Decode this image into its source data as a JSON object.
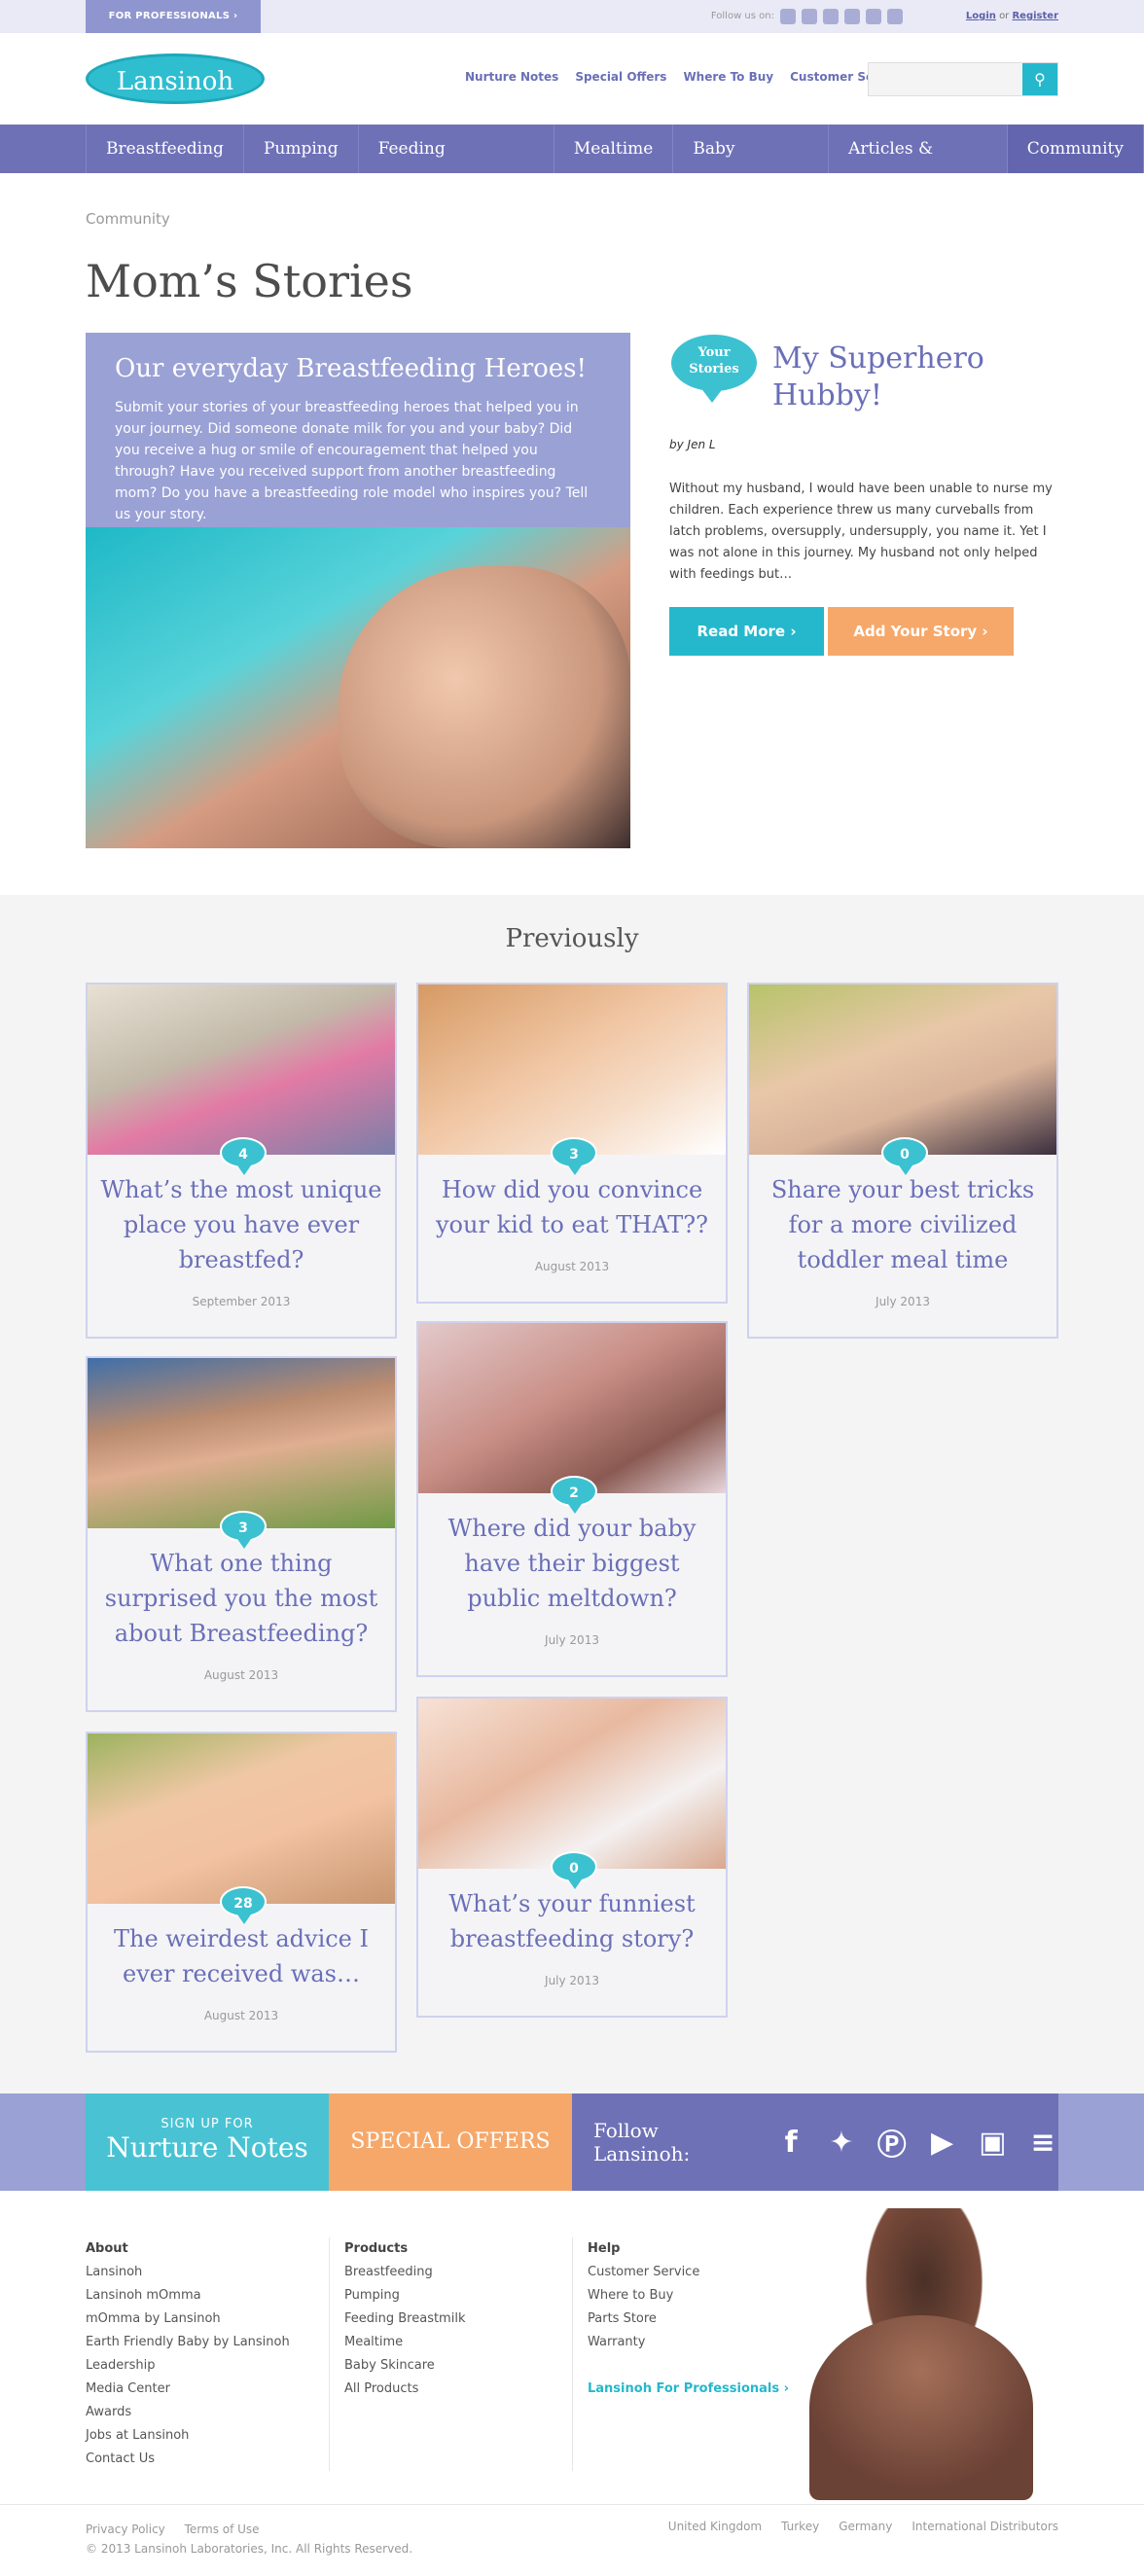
{
  "topbar": {
    "pro_label": "FOR PROFESSIONALS ›",
    "follow_label": "Follow us on:",
    "login": "Login",
    "or": "or",
    "register": "Register"
  },
  "header": {
    "logo": "Lansinoh",
    "util_nav": [
      "Nurture Notes",
      "Special Offers",
      "Where To Buy",
      "Customer Service"
    ],
    "search_placeholder": ""
  },
  "main_nav": [
    "Breastfeeding",
    "Pumping",
    "Feeding Breastmilk",
    "Mealtime",
    "Baby Skincare",
    "Articles & Videos",
    "Community"
  ],
  "breadcrumb": "Community",
  "page_title": "Mom’s Stories",
  "hero": {
    "heading": "Our everyday Breastfeeding Heroes!",
    "body": "Submit your stories of your breastfeeding heroes that helped you in your journey. Did someone donate milk for you and your baby? Did you receive a hug or smile of encouragement that helped you through? Have you received support from another breastfeeding mom? Do you have a breastfeeding role model who inspires you? Tell us your story."
  },
  "featured": {
    "bubble_line1": "Your",
    "bubble_line2": "Stories",
    "title": "My Superhero Hubby!",
    "byline": "by Jen L",
    "text": "Without my husband, I would have been unable to nurse my children. Each experience threw us many curveballs from latch problems, oversupply, undersupply, you name it. Yet I was not alone in this journey. My husband not only helped with feedings but…",
    "read_more": "Read More ›",
    "add_story": "Add Your Story ›"
  },
  "previously": {
    "title": "Previously",
    "cards": [
      {
        "count": "4",
        "question": "What’s the most unique place you have ever breastfed?",
        "date": "September 2013"
      },
      {
        "count": "3",
        "question": "How did you convince your kid to eat THAT??",
        "date": "August 2013"
      },
      {
        "count": "0",
        "question": "Share your best tricks for a more civilized toddler meal time",
        "date": "July 2013"
      },
      {
        "count": "3",
        "question": "What one thing surprised you the most about Breastfeeding?",
        "date": "August 2013"
      },
      {
        "count": "2",
        "question": "Where did your baby have their biggest public meltdown?",
        "date": "July 2013"
      },
      {
        "count": "28",
        "question": "The weirdest advice I ever received was…",
        "date": "August 2013"
      },
      {
        "count": "0",
        "question": "What’s your funniest breastfeeding story?",
        "date": "July 2013"
      }
    ]
  },
  "promo": {
    "signup_small": "SIGN UP FOR",
    "signup_big": "Nurture Notes",
    "special_offers": "SPECIAL OFFERS",
    "follow_label": "Follow Lansinoh:"
  },
  "footer": {
    "about_head": "About",
    "about": [
      "Lansinoh",
      "Lansinoh mOmma",
      "mOmma by Lansinoh",
      "Earth Friendly Baby by Lansinoh",
      "Leadership",
      "Media Center",
      "Awards",
      "Jobs at Lansinoh",
      "Contact Us"
    ],
    "products_head": "Products",
    "products": [
      "Breastfeeding",
      "Pumping",
      "Feeding Breastmilk",
      "Mealtime",
      "Baby Skincare",
      "All Products"
    ],
    "help_head": "Help",
    "help": [
      "Customer Service",
      "Where to Buy",
      "Parts Store",
      "Warranty"
    ],
    "pro_link": "Lansinoh For Professionals ›",
    "privacy": "Privacy Policy",
    "terms": "Terms of Use",
    "copyright": "© 2013 Lansinoh Laboratories, Inc. All Rights Reserved.",
    "countries": [
      "United Kingdom",
      "Turkey",
      "Germany",
      "International Distributors"
    ]
  }
}
